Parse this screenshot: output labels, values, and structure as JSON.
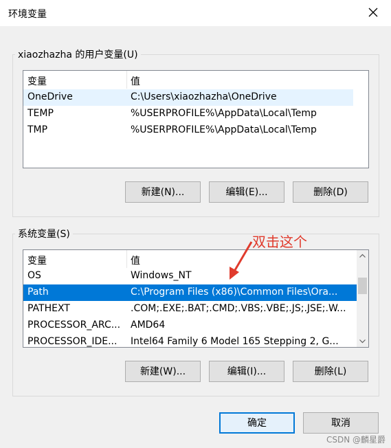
{
  "window": {
    "title": "环境变量",
    "close_icon": "close-icon"
  },
  "user_vars": {
    "legend": "xiaozhazha 的用户变量(U)",
    "headers": [
      "变量",
      "值"
    ],
    "rows": [
      {
        "name": "OneDrive",
        "value": "C:\\Users\\xiaozhazha\\OneDrive"
      },
      {
        "name": "TEMP",
        "value": "%USERPROFILE%\\AppData\\Local\\Temp"
      },
      {
        "name": "TMP",
        "value": "%USERPROFILE%\\AppData\\Local\\Temp"
      }
    ],
    "buttons": {
      "new": "新建(N)...",
      "edit": "编辑(E)...",
      "delete": "删除(D)"
    }
  },
  "system_vars": {
    "legend": "系统变量(S)",
    "headers": [
      "变量",
      "值"
    ],
    "rows": [
      {
        "name": "OS",
        "value": "Windows_NT"
      },
      {
        "name": "Path",
        "value": "C:\\Program Files (x86)\\Common Files\\Ora..."
      },
      {
        "name": "PATHEXT",
        "value": ".COM;.EXE;.BAT;.CMD;.VBS;.VBE;.JS;.JSE;.W..."
      },
      {
        "name": "PROCESSOR_ARC...",
        "value": "AMD64"
      },
      {
        "name": "PROCESSOR_IDE...",
        "value": "Intel64 Family 6 Model 165 Stepping 2, G..."
      }
    ],
    "buttons": {
      "new": "新建(W)...",
      "edit": "编辑(I)...",
      "delete": "删除(L)"
    }
  },
  "annotation": "双击这个",
  "footer": {
    "ok": "确定",
    "cancel": "取消"
  },
  "watermark": "CSDN @麟星爵",
  "colors": {
    "selection": "#0078d7",
    "annotation": "#e03b2d"
  }
}
